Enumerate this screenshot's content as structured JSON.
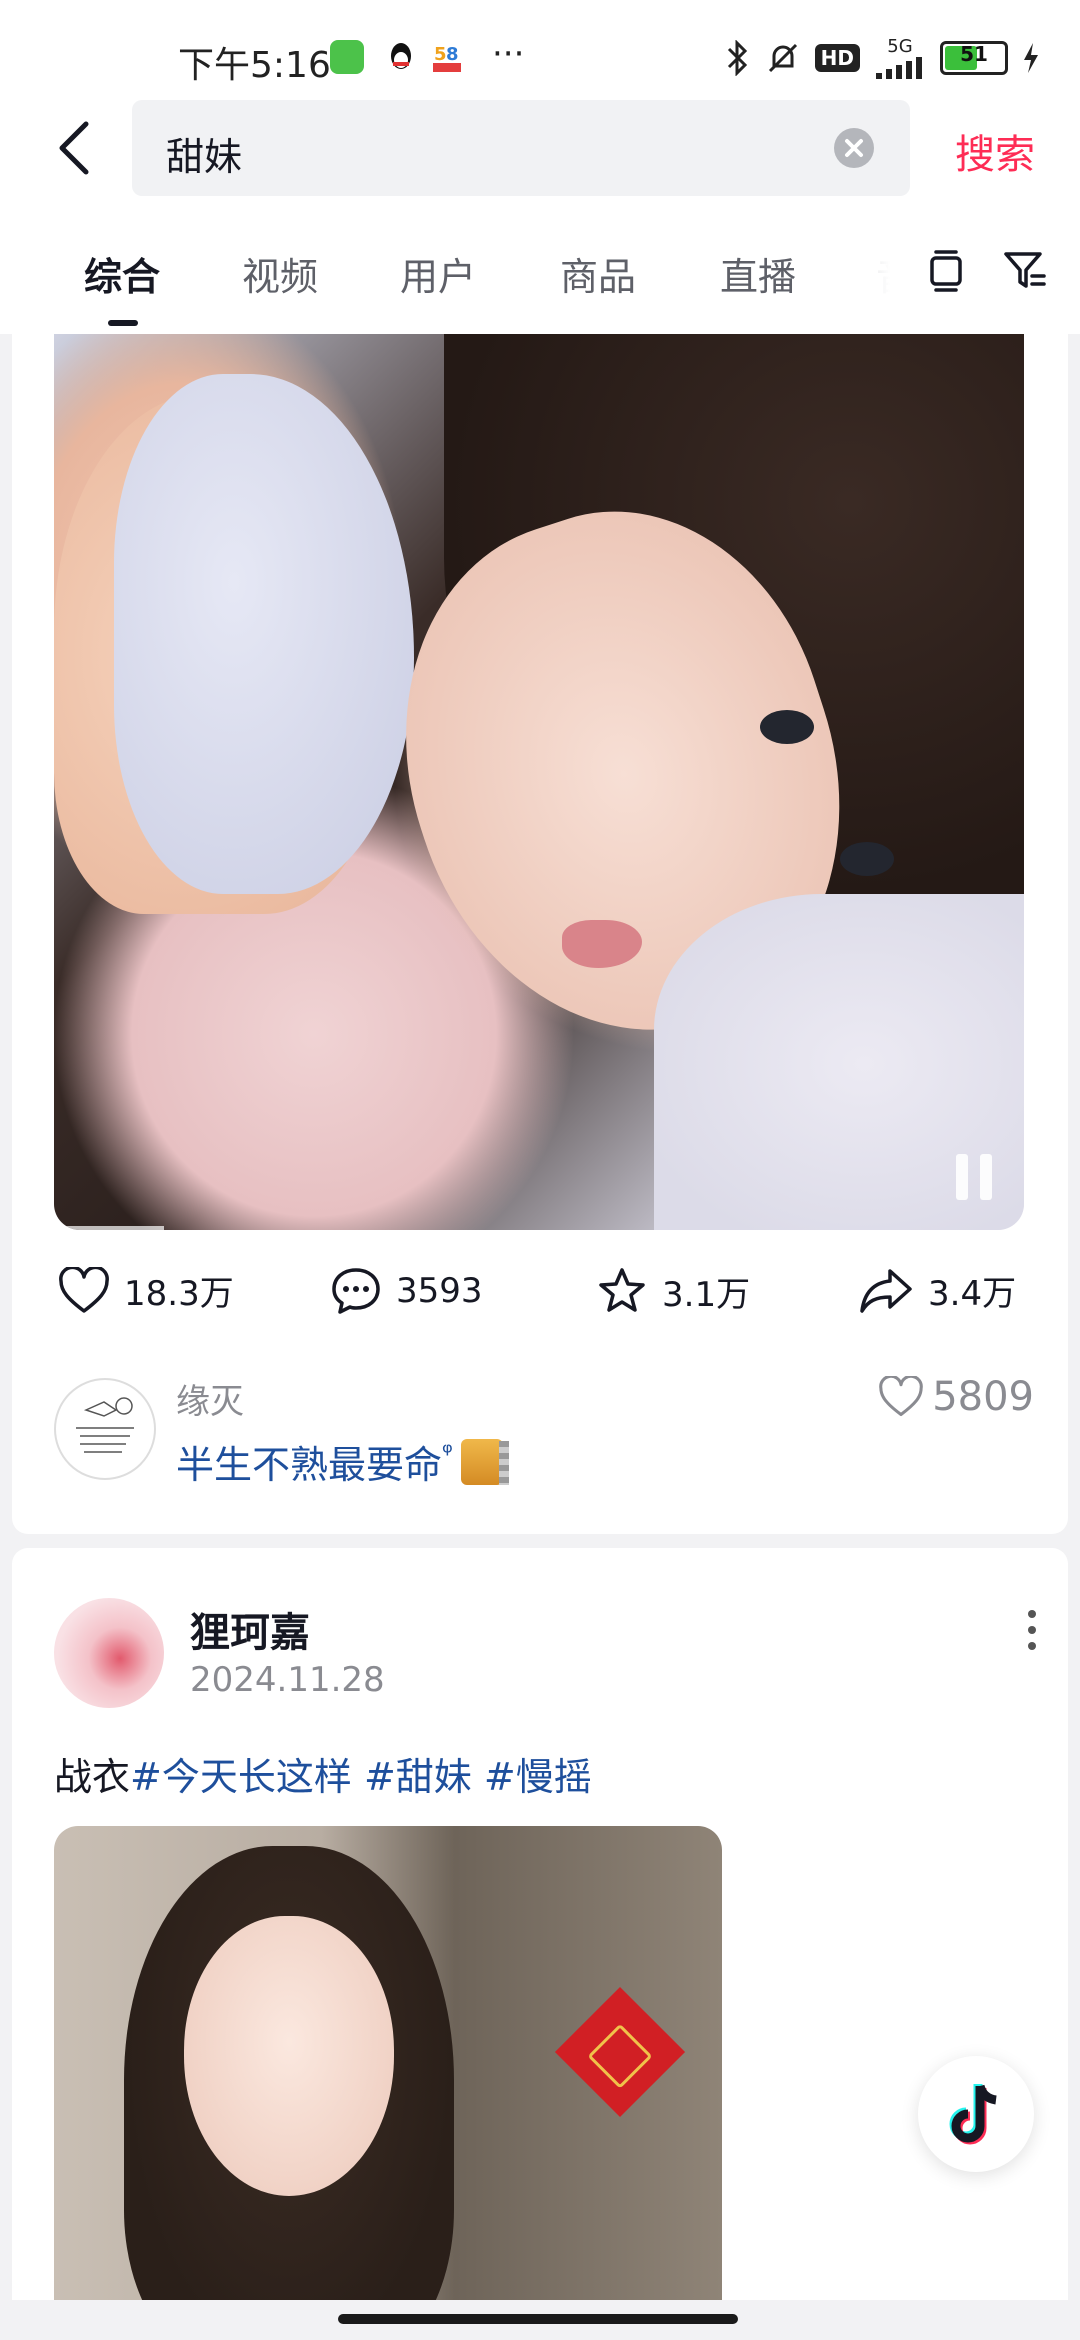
{
  "status_bar": {
    "time": "下午5:16",
    "network": "5G",
    "hd_label": "HD",
    "battery_level": "51",
    "app_icons": [
      "wechat-icon",
      "qq-icon",
      "58-app-icon"
    ],
    "more": "···"
  },
  "search": {
    "query": "甜妹",
    "search_button": "搜索"
  },
  "tabs": {
    "items": [
      "综合",
      "视频",
      "用户",
      "商品",
      "直播",
      "音"
    ],
    "active_index": 0
  },
  "video_card": {
    "likes": "18.3万",
    "comments": "3593",
    "favorites": "3.1万",
    "shares": "3.4万",
    "top_comment": {
      "user": "缘灭",
      "text": "半生不熟最要命",
      "search_mark": "ᵠ",
      "like_count": "5809"
    }
  },
  "post_card": {
    "author": "狸珂嘉",
    "date": "2024.11.28",
    "caption_prefix": "战衣",
    "hashtags": [
      "#今天长这样",
      "#甜妹",
      "#慢摇"
    ]
  },
  "colors": {
    "accent": "#fe2c55",
    "hashtag": "#1e4f9c",
    "secondary_text": "#8a8b91"
  }
}
